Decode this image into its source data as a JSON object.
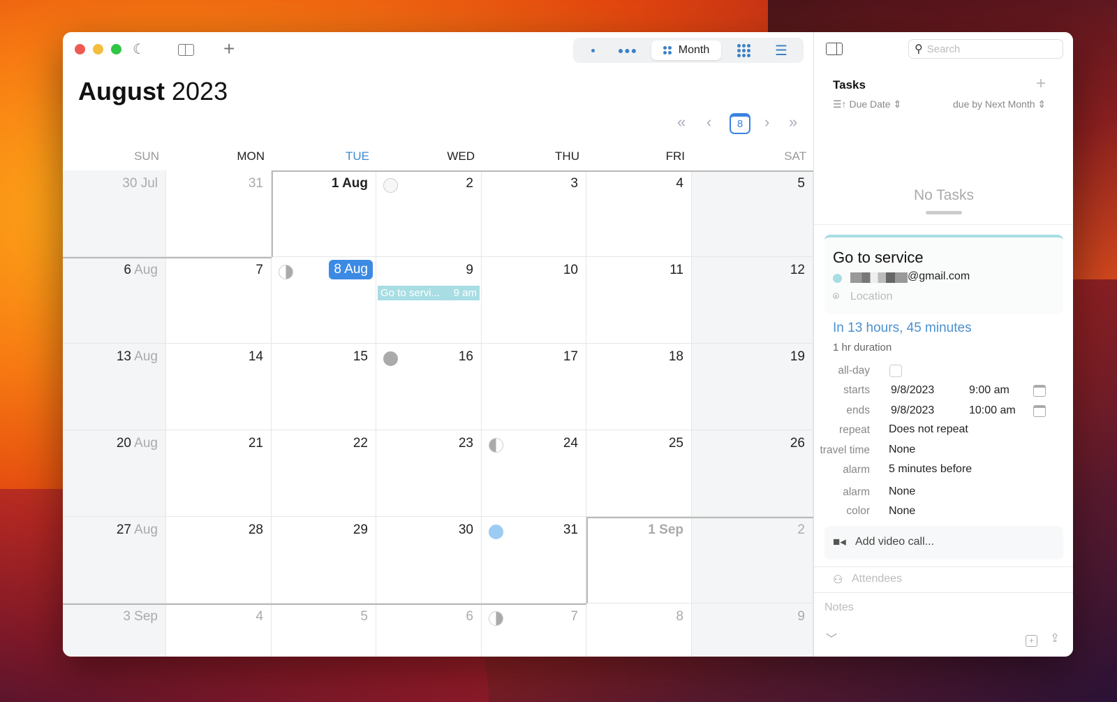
{
  "toolbar": {
    "view_options": [
      "day",
      "week",
      "Month",
      "year",
      "list"
    ],
    "active_view": "Month",
    "today_badge": "8"
  },
  "header": {
    "month": "August",
    "year": "2023"
  },
  "weekdays": [
    "SUN",
    "MON",
    "TUE",
    "WED",
    "THU",
    "FRI",
    "SAT"
  ],
  "today_weekday_index": 2,
  "weeks": [
    [
      {
        "d": "30",
        "m": "Jul",
        "dim": true
      },
      {
        "d": "31",
        "dim": true
      },
      {
        "d": "1 Aug",
        "bold": true
      },
      {
        "d": "2",
        "moon": "full-outline"
      },
      {
        "d": "3"
      },
      {
        "d": "4"
      },
      {
        "d": "5"
      }
    ],
    [
      {
        "d": "6",
        "m": "Aug"
      },
      {
        "d": "7"
      },
      {
        "d": "8 Aug",
        "selected": true,
        "moon": "last-quarter"
      },
      {
        "d": "9",
        "event": {
          "title": "Go to servi...",
          "time": "9 am"
        }
      },
      {
        "d": "10"
      },
      {
        "d": "11"
      },
      {
        "d": "12"
      }
    ],
    [
      {
        "d": "13",
        "m": "Aug"
      },
      {
        "d": "14"
      },
      {
        "d": "15"
      },
      {
        "d": "16",
        "moon": "new"
      },
      {
        "d": "17"
      },
      {
        "d": "18"
      },
      {
        "d": "19"
      }
    ],
    [
      {
        "d": "20",
        "m": "Aug"
      },
      {
        "d": "21"
      },
      {
        "d": "22"
      },
      {
        "d": "23"
      },
      {
        "d": "24",
        "moon": "first-quarter"
      },
      {
        "d": "25"
      },
      {
        "d": "26"
      }
    ],
    [
      {
        "d": "27",
        "m": "Aug"
      },
      {
        "d": "28"
      },
      {
        "d": "29"
      },
      {
        "d": "30"
      },
      {
        "d": "31",
        "moon": "full"
      },
      {
        "d": "1 Sep",
        "bold": true,
        "dim": true
      },
      {
        "d": "2",
        "dim": true
      }
    ],
    [
      {
        "d": "3",
        "m": "Sep",
        "dim": true
      },
      {
        "d": "4",
        "dim": true
      },
      {
        "d": "5",
        "dim": true
      },
      {
        "d": "6",
        "dim": true
      },
      {
        "d": "7",
        "dim": true,
        "moon": "last-quarter"
      },
      {
        "d": "8",
        "dim": true
      },
      {
        "d": "9",
        "dim": true
      }
    ]
  ],
  "sidebar": {
    "search_placeholder": "Search",
    "tasks_title": "Tasks",
    "sort_label": "Due Date",
    "filter_label": "due by Next Month",
    "empty_text": "No Tasks",
    "event": {
      "title": "Go to service",
      "calendar": "@gmail.com",
      "location_placeholder": "Location",
      "countdown": "In 13 hours, 45 minutes",
      "duration": "1 hr duration",
      "allday_label": "all-day",
      "starts_label": "starts",
      "starts_date": "9/8/2023",
      "starts_time": "9:00 am",
      "ends_label": "ends",
      "ends_date": "9/8/2023",
      "ends_time": "10:00 am",
      "repeat_label": "repeat",
      "repeat_value": "Does not repeat",
      "travel_label": "travel time",
      "travel_value": "None",
      "alarm1_label": "alarm",
      "alarm1_value": "5 minutes before",
      "alarm2_label": "alarm",
      "alarm2_value": "None",
      "color_label": "color",
      "color_value": "None",
      "video_label": "Add video call...",
      "attendees_placeholder": "Attendees",
      "notes_placeholder": "Notes"
    }
  },
  "colors": {
    "accent": "#3c8ae3",
    "event": "#a8dde3",
    "countdown": "#4a90d0"
  }
}
